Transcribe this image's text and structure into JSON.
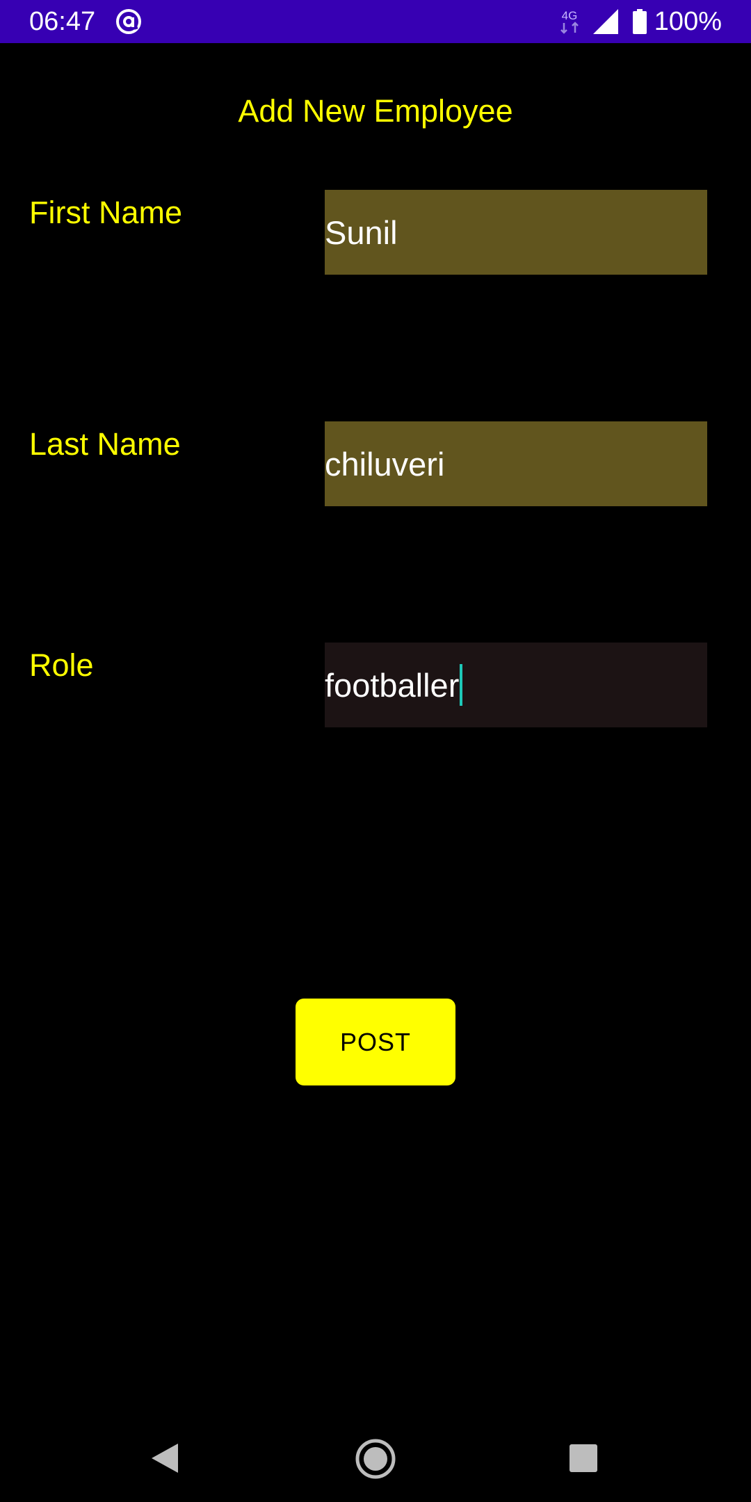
{
  "status_bar": {
    "time": "06:47",
    "network_type": "4G",
    "battery_percent": "100%",
    "background_color": "#3700b3"
  },
  "page": {
    "title": "Add New Employee"
  },
  "form": {
    "first_name": {
      "label": "First Name",
      "value": "Sunil"
    },
    "last_name": {
      "label": "Last Name",
      "value": "chiluveri"
    },
    "role": {
      "label": "Role",
      "value": "footballer"
    }
  },
  "actions": {
    "post_label": "POST"
  },
  "colors": {
    "accent": "#ffff00",
    "filled_field_bg": "#61551e",
    "focused_field_bg": "#1c1314",
    "caret": "#1ec8b8",
    "background": "#000000"
  },
  "icons": {
    "status_app": "at-sign-icon",
    "signal": "signal-icon",
    "battery": "battery-icon",
    "nav_back": "back-triangle-icon",
    "nav_home": "home-circle-icon",
    "nav_recents": "recents-square-icon"
  }
}
